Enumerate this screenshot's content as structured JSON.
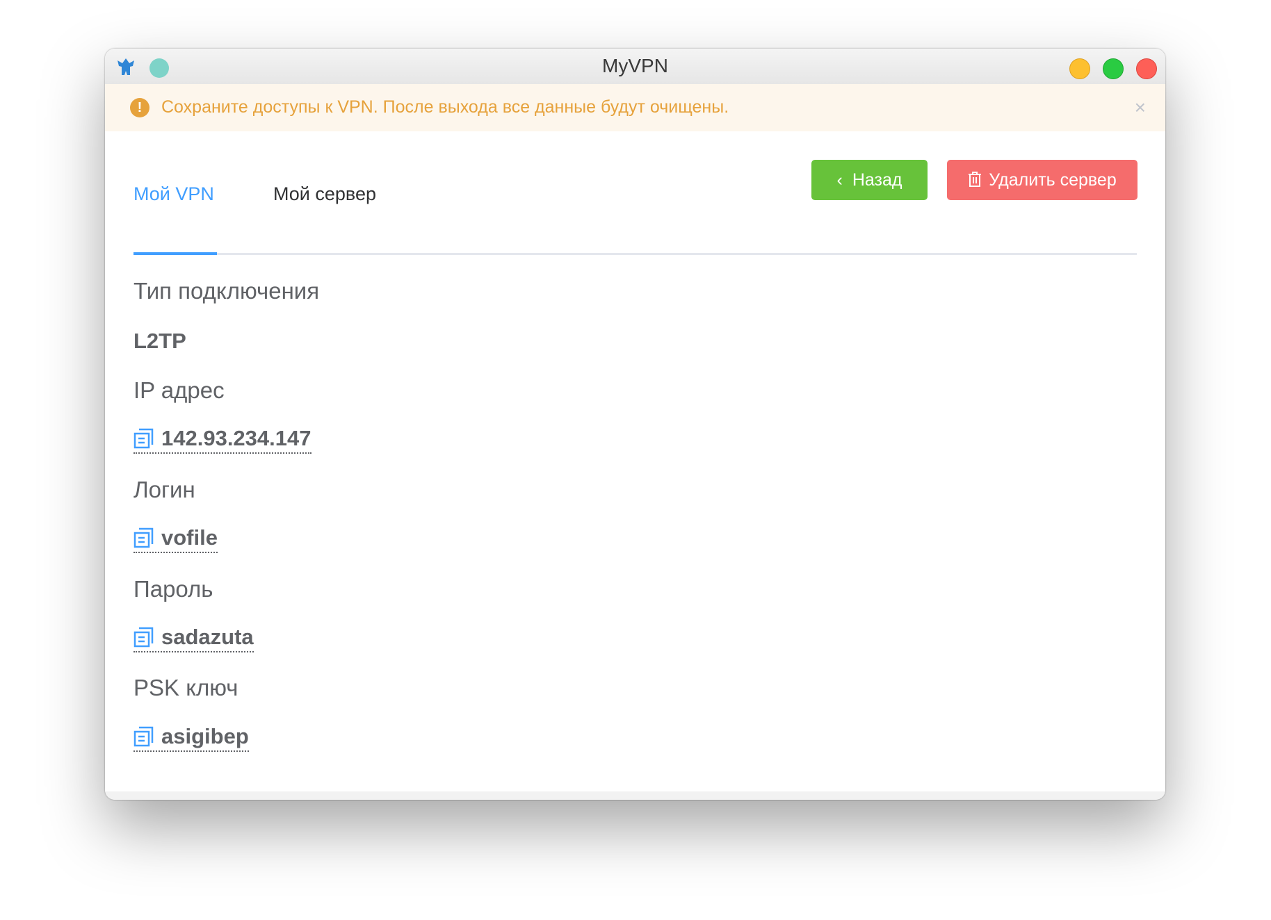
{
  "window": {
    "title": "MyVPN"
  },
  "banner": {
    "text": "Сохраните доступы к VPN. После выхода все данные будут очищены.",
    "close": "×"
  },
  "actions": {
    "back_label": "Назад",
    "delete_label": "Удалить сервер"
  },
  "tabs": [
    {
      "label": "Мой VPN",
      "active": true
    },
    {
      "label": "Мой сервер",
      "active": false
    }
  ],
  "fields": [
    {
      "label": "Тип подключения",
      "value": "L2TP",
      "copyable": false
    },
    {
      "label": "IP адрес",
      "value": "142.93.234.147",
      "copyable": true
    },
    {
      "label": "Логин",
      "value": "vofile",
      "copyable": true
    },
    {
      "label": "Пароль",
      "value": "sadazuta",
      "copyable": true
    },
    {
      "label": "PSK ключ",
      "value": "asigibep",
      "copyable": true
    }
  ],
  "colors": {
    "accent": "#409eff",
    "success": "#67c23a",
    "danger": "#f56c6c",
    "warning": "#e6a23c"
  }
}
